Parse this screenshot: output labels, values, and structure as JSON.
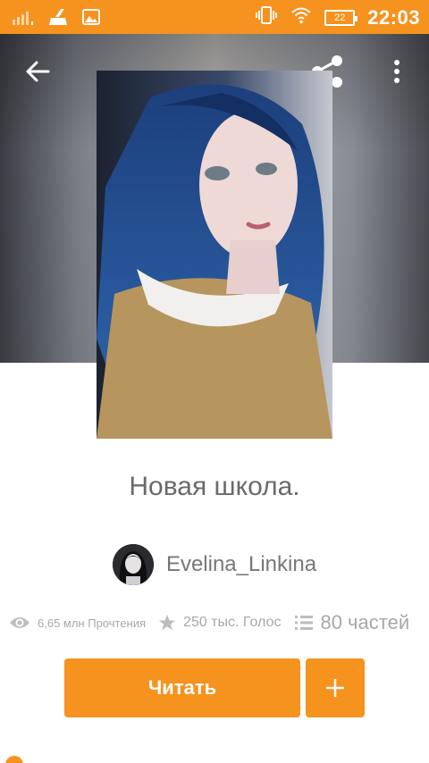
{
  "status_bar": {
    "time": "22:03",
    "battery": "22",
    "icons": [
      "signal-icon",
      "cleaner-icon",
      "gallery-icon",
      "vibrate-icon",
      "wifi-icon",
      "battery-icon"
    ]
  },
  "header": {
    "icons": [
      "back-arrow-icon",
      "share-icon",
      "more-vertical-icon"
    ]
  },
  "story": {
    "title": "Новая школа.",
    "author": "Evelina_Linkina",
    "stats": {
      "reads": "6,65 млн Прочтения",
      "votes": "250 тыс. Голос",
      "parts": "80 частей"
    }
  },
  "actions": {
    "read_label": "Читать",
    "add_label": "+"
  },
  "colors": {
    "accent": "#f6921e",
    "text": "#6a6a6a",
    "muted": "#a8a8a8"
  }
}
